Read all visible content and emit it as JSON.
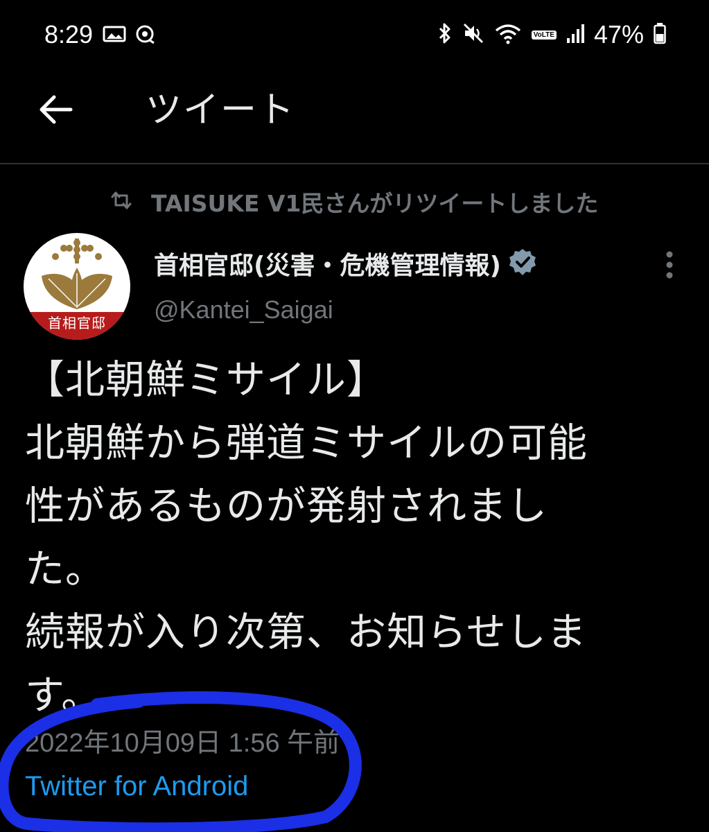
{
  "status_bar": {
    "time": "8:29",
    "battery": "47%",
    "network_badge": "VoLTE",
    "icons": [
      "gallery-icon",
      "sync-icon",
      "bluetooth-icon",
      "mute-icon",
      "wifi-icon",
      "signal-icon",
      "battery-icon"
    ]
  },
  "header": {
    "title": "ツイート",
    "back_icon": "arrow-left-icon"
  },
  "retweet": {
    "label": "TAISUKE V1民さんがリツイートしました",
    "icon": "retweet-icon"
  },
  "author": {
    "name": "首相官邸(災害・危機管理情報)",
    "handle": "@Kantei_Saigai",
    "avatar_label": "首相官邸",
    "verified_icon": "verified-badge-icon",
    "more_icon": "more-vertical-icon"
  },
  "tweet": {
    "text": "【北朝鮮ミサイル】\n北朝鮮から弾道ミサイルの可能\n性があるものが発射されまし\nた。\n続報が入り次第、お知らせしま\nす。",
    "timestamp": "2022年10月09日 1:56 午前 ·",
    "source": "Twitter for Android"
  },
  "colors": {
    "background": "#000000",
    "text_primary": "#e7e9ea",
    "text_secondary": "#71767b",
    "link": "#1d9bf0",
    "annotation": "#1a2fe6",
    "avatar_band": "#b71c1c"
  }
}
